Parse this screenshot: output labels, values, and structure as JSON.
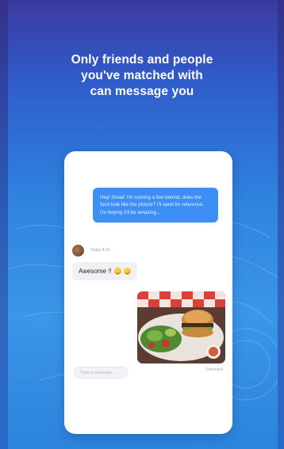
{
  "headline": {
    "line1": "Only friends and people",
    "line2": "you've matched with",
    "line3": "can message you"
  },
  "chat": {
    "outgoing_message": "Hey! Great! I'm running a few behind, does the food look like the picture? I'll send for reference. I'm hoping it'll be amazing...",
    "incoming_sender_meta": "Today 8:16",
    "incoming_message": "Awesome !!",
    "incoming_emojis": [
      "grinning-emoji",
      "grinning-emoji"
    ],
    "delivered_label": "Delivered",
    "composer_placeholder": "Type a message..."
  },
  "colors": {
    "background_top": "#3b3aa0",
    "background_bottom": "#2c84dd",
    "outgoing_bubble": "#3d8ef5",
    "incoming_bubble": "#f0f1f4"
  }
}
